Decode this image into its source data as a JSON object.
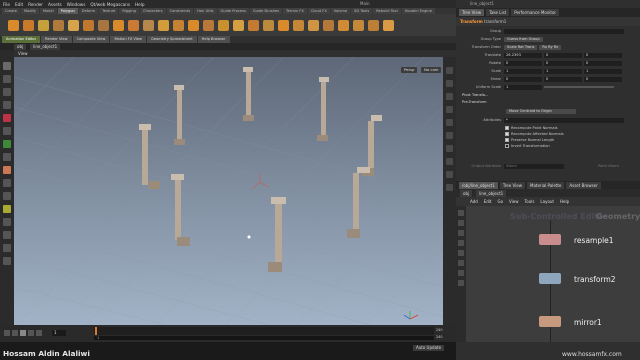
{
  "menu": [
    "File",
    "Edit",
    "Render",
    "Assets",
    "Windows",
    "Qt/web Megascans",
    "Help"
  ],
  "window_title": "Main",
  "shelf_tabs": [
    "Create",
    "Modify",
    "Model",
    "Polygon",
    "Deform",
    "Texture",
    "Rigging",
    "Characters",
    "Constraints",
    "Hair Utils",
    "Guide Process",
    "Guide Brushes",
    "Terrain FX",
    "Cloud FX",
    "Volume",
    "SD Tools",
    "Rebuild Tool",
    "Houdini Engine"
  ],
  "shelf_active_tab": "Polygon",
  "panel_tabs": [
    "Animation Editor",
    "Render View",
    "Composite View",
    "Motion FX View",
    "Geometry Spreadsheet",
    "Help Browser"
  ],
  "path": {
    "root": "obj",
    "node": "line_object1"
  },
  "viewport": {
    "label": "View",
    "persp": "Persp",
    "camera": "No cam"
  },
  "timeline": {
    "frame": "1",
    "start": "1",
    "end": "240",
    "end2": "240"
  },
  "status": {
    "auto_update": "Auto Update"
  },
  "author": "Hossam Aldin Alaliwi",
  "site": "www.hossamfx.com",
  "right_tabs": [
    "Tree View",
    "Take List",
    "Performance Monitor"
  ],
  "right_path": "line_object1",
  "xform": {
    "type": "Transform",
    "name": "transform1"
  },
  "params": {
    "group_label": "Group",
    "group_val": "",
    "group_type_label": "Group Type",
    "group_type_val": "Guess from Group",
    "xform_order_label": "Transform Order",
    "xform_order_val": "Scale Rot Trans",
    "rot_order_val": "Rx Ry Rz",
    "translate_label": "Translate",
    "translate": [
      "26.2393",
      "0",
      "0"
    ],
    "rotate_label": "Rotate",
    "rotate": [
      "0",
      "0",
      "0"
    ],
    "scale_label": "Scale",
    "scale": [
      "1",
      "1",
      "1"
    ],
    "shear_label": "Shear",
    "shear": [
      "0",
      "0",
      "0"
    ],
    "uniform_label": "Uniform Scale",
    "uniform": "1",
    "pivot_xform": "Pivot Transfo...",
    "pre_xform": "Pre-Transform",
    "move_centroid": "Move Centroid to Origin",
    "attributes_label": "Attributes",
    "attributes_val": "*",
    "cb1": "Recompute Point Normals",
    "cb2": "Recompute Affected Normals",
    "cb3": "Preserve Normal Length",
    "cb4": "Invert Transformation",
    "output_label": "Output Attribute",
    "output_val": "Xform",
    "output_right": "Point Xform"
  },
  "net_tabs": [
    "/obj/line_object1",
    "Tree View",
    "Material Palette",
    "Asset Browser"
  ],
  "net_path": {
    "root": "obj",
    "node": "line_object1"
  },
  "net_menu": [
    "Add",
    "Edit",
    "Go",
    "View",
    "Tools",
    "Layout",
    "Help"
  ],
  "net_watermark_ctx": "Sub-Controlled Editor",
  "net_watermark_geo": "Geometry",
  "nodes": [
    {
      "label": "resample1",
      "color": "#c98d8d"
    },
    {
      "label": "transform2",
      "color": "#8fa7bd"
    },
    {
      "label": "mirror1",
      "color": "#c79a80"
    }
  ],
  "colors": {
    "accent": "#ff9c3a",
    "selected_tab": "#5a6e3a",
    "viewport_top": "#5d6777",
    "viewport_bottom": "#a3b3c7"
  }
}
